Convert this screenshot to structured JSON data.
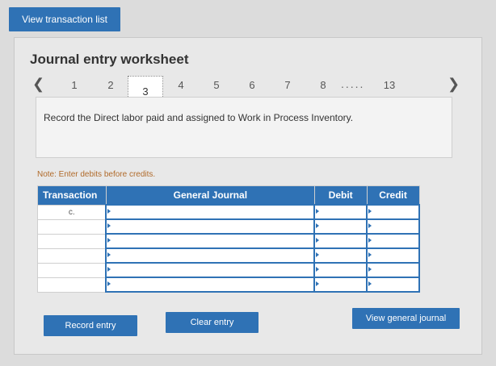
{
  "header": {
    "view_transactions_label": "View transaction list"
  },
  "worksheet": {
    "title": "Journal entry worksheet"
  },
  "pagination": {
    "prev_icon": "chevron-left-icon",
    "next_icon": "chevron-right-icon",
    "pages": [
      "1",
      "2",
      "3",
      "4",
      "5",
      "6",
      "7",
      "8"
    ],
    "ellipsis": ".....",
    "last_page": "13",
    "active_page": "3"
  },
  "instruction": {
    "text": "Record the Direct labor paid and assigned to Work in Process Inventory."
  },
  "note": {
    "text": "Note: Enter debits before credits."
  },
  "table": {
    "headers": {
      "transaction": "Transaction",
      "general_journal": "General Journal",
      "debit": "Debit",
      "credit": "Credit"
    },
    "rows": [
      {
        "transaction": "c."
      },
      {
        "transaction": ""
      },
      {
        "transaction": ""
      },
      {
        "transaction": ""
      },
      {
        "transaction": ""
      },
      {
        "transaction": ""
      }
    ]
  },
  "buttons": {
    "record": "Record entry",
    "clear": "Clear entry",
    "view_journal": "View general journal"
  }
}
